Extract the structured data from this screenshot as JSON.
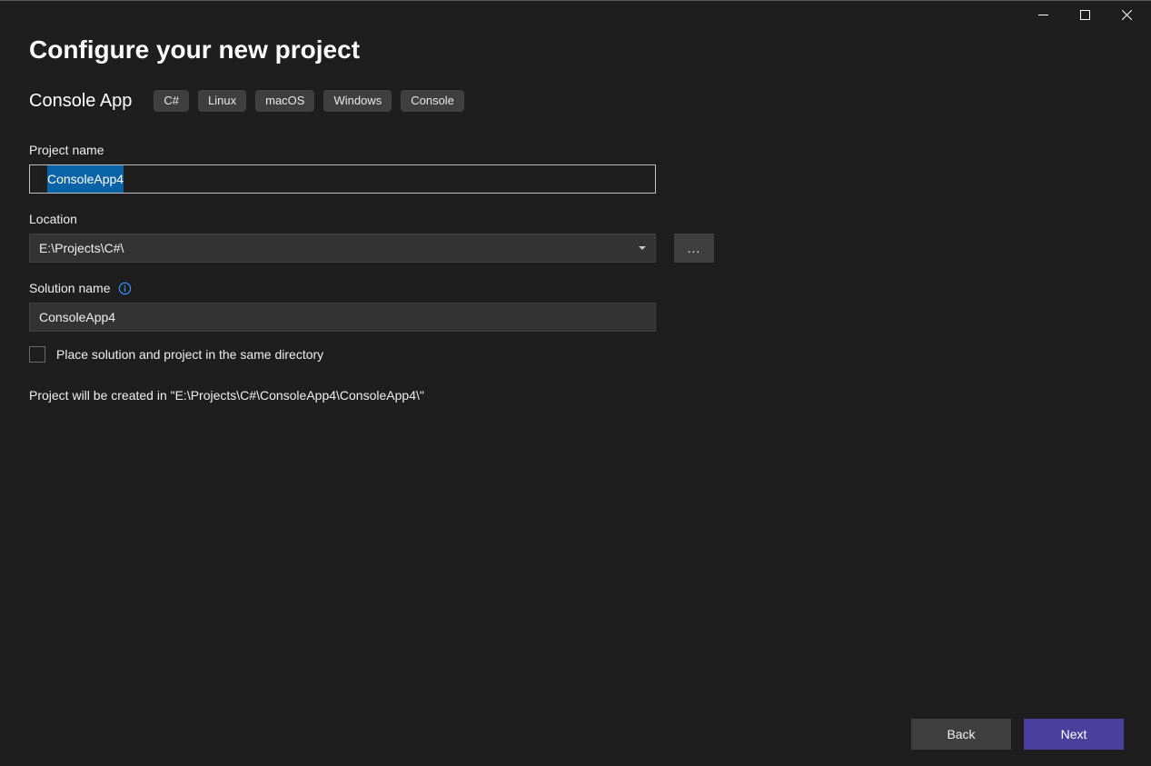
{
  "header": {
    "title": "Configure your new project"
  },
  "template": {
    "name": "Console App",
    "tags": [
      "C#",
      "Linux",
      "macOS",
      "Windows",
      "Console"
    ]
  },
  "fields": {
    "project_name": {
      "label": "Project name",
      "value": "ConsoleApp4"
    },
    "location": {
      "label": "Location",
      "value": "E:\\Projects\\C#\\",
      "browse_label": "..."
    },
    "solution_name": {
      "label": "Solution name",
      "value": "ConsoleApp4"
    },
    "same_directory": {
      "label": "Place solution and project in the same directory",
      "checked": false
    }
  },
  "preview_path": "Project will be created in \"E:\\Projects\\C#\\ConsoleApp4\\ConsoleApp4\\\"",
  "footer": {
    "back": "Back",
    "next": "Next"
  },
  "icons": {
    "info": "info-icon",
    "minimize": "minimize-icon",
    "maximize": "maximize-icon",
    "close": "close-icon",
    "dropdown": "chevron-down-icon"
  }
}
